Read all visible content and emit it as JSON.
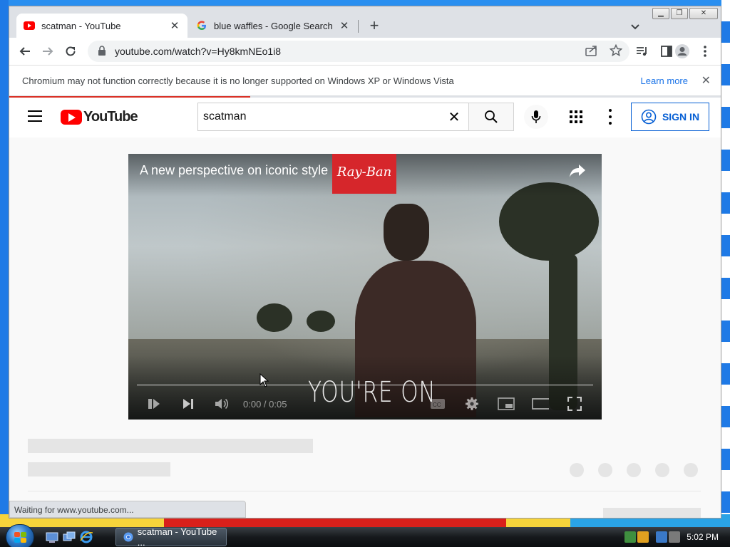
{
  "browser": {
    "tabs": [
      {
        "title": "scatman - YouTube",
        "active": true
      },
      {
        "title": "blue waffles - Google Search",
        "active": false
      }
    ],
    "address": "youtube.com/watch?v=Hy8kmNEo1i8",
    "infobar": {
      "message": "Chromium may not function correctly because it is no longer supported on Windows XP or Windows Vista",
      "learn_more": "Learn more"
    },
    "status_text": "Waiting for www.youtube.com..."
  },
  "youtube": {
    "logo_text": "YouTube",
    "search_query": "scatman",
    "sign_in": "SIGN IN",
    "video": {
      "ad_title": "A new perspective on iconic style",
      "brand": "Ray-Ban",
      "overlay_text": "YOU'RE ON",
      "time": "0:00 / 0:05",
      "progress": 0.0
    }
  },
  "taskbar": {
    "task_label": "scatman - YouTube ...",
    "clock": "5:02 PM"
  },
  "colors": {
    "youtube_red": "#ff0000",
    "link_blue": "#065fd4",
    "load_bar": "#d93025"
  }
}
